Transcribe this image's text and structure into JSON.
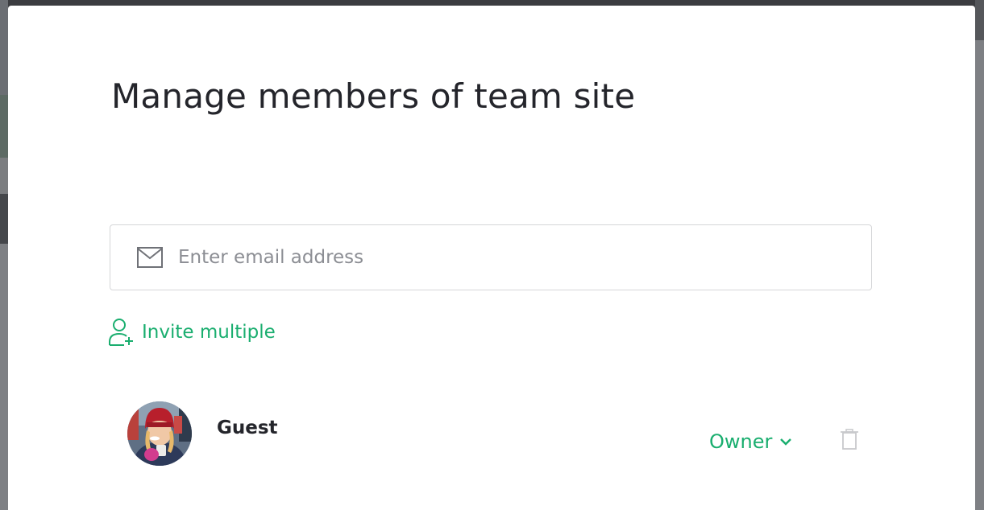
{
  "modal": {
    "title": "Manage members of team site"
  },
  "email_input": {
    "placeholder": "Enter email address",
    "value": "",
    "icon": "mail-icon"
  },
  "invite": {
    "label": "Invite multiple",
    "icon": "add-user-icon"
  },
  "members": [
    {
      "name": "Guest",
      "role": "Owner",
      "avatar": "avatar-photo",
      "actions": [
        "delete-icon"
      ]
    }
  ],
  "colors": {
    "accent": "#1aae6f",
    "title_text": "#24252b",
    "placeholder": "#8c8e94",
    "border": "#d5d6d8",
    "disabled_icon": "#c8c9cc"
  }
}
